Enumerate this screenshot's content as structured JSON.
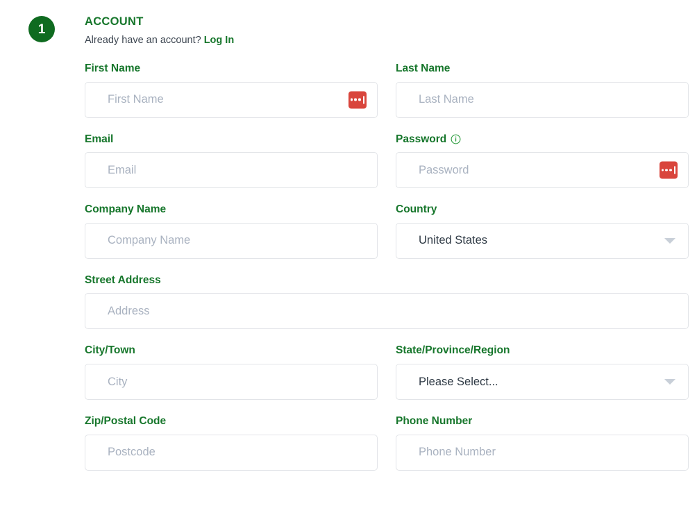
{
  "step": {
    "number": "1"
  },
  "header": {
    "title": "ACCOUNT",
    "subtitle_text": "Already have an account?",
    "login_label": "Log In"
  },
  "colors": {
    "green": "#16762b",
    "badge_green": "#0f6b20",
    "placeholder": "#a9b2c0",
    "border": "#e2e4e8",
    "password_manager_red": "#d9453c",
    "caret_grey": "#c8cfd8",
    "value_text": "#2f3a45"
  },
  "fields": {
    "first_name": {
      "label": "First Name",
      "placeholder": "First Name",
      "value": ""
    },
    "last_name": {
      "label": "Last Name",
      "placeholder": "Last Name",
      "value": ""
    },
    "email": {
      "label": "Email",
      "placeholder": "Email",
      "value": ""
    },
    "password": {
      "label": "Password",
      "placeholder": "Password",
      "value": ""
    },
    "company": {
      "label": "Company Name",
      "placeholder": "Company Name",
      "value": ""
    },
    "country": {
      "label": "Country",
      "value": "United States"
    },
    "street": {
      "label": "Street Address",
      "placeholder": "Address",
      "value": ""
    },
    "city": {
      "label": "City/Town",
      "placeholder": "City",
      "value": ""
    },
    "state": {
      "label": "State/Province/Region",
      "value": "Please Select..."
    },
    "zip": {
      "label": "Zip/Postal Code",
      "placeholder": "Postcode",
      "value": ""
    },
    "phone": {
      "label": "Phone Number",
      "placeholder": "Phone Number",
      "value": ""
    }
  },
  "icons": {
    "password_manager": "lastpass-fill-icon",
    "info": "info-circle-icon",
    "caret": "chevron-down-icon"
  }
}
